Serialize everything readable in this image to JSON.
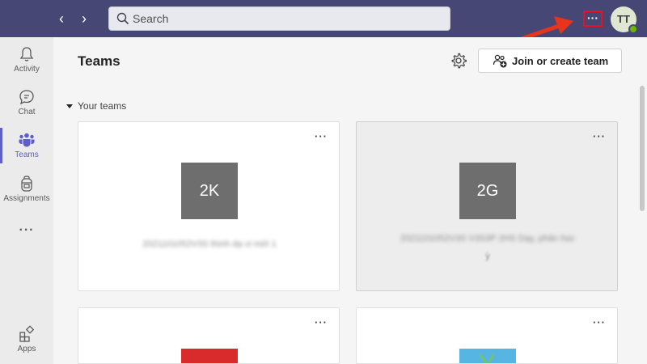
{
  "topbar": {
    "search_placeholder": "Search",
    "more_label": "···",
    "avatar_initials": "TT",
    "bg_color": "#464775"
  },
  "rail": {
    "items": [
      {
        "label": "Activity",
        "icon": "bell-icon"
      },
      {
        "label": "Chat",
        "icon": "chat-icon"
      },
      {
        "label": "Teams",
        "icon": "teams-icon"
      },
      {
        "label": "Assignments",
        "icon": "backpack-icon"
      },
      {
        "label": "Apps",
        "icon": "apps-icon"
      }
    ],
    "more_label": "···",
    "active": "Teams"
  },
  "main": {
    "title": "Teams",
    "join_button": "Join or create team",
    "section_label": "Your teams",
    "cards": [
      {
        "initials": "2K",
        "name": "2021101052V3S thinh dạ vi mới 1",
        "more": "···"
      },
      {
        "initials": "2G",
        "name": "2021101052V3S V3S3P 2HS Dạy, phân học",
        "name_line2": "ỳ",
        "more": "···"
      },
      {
        "initials": "",
        "name": "",
        "more": "···"
      },
      {
        "initials": "",
        "name": "",
        "more": "···"
      }
    ]
  },
  "annotation": {
    "arrow_color": "#e8341c"
  }
}
